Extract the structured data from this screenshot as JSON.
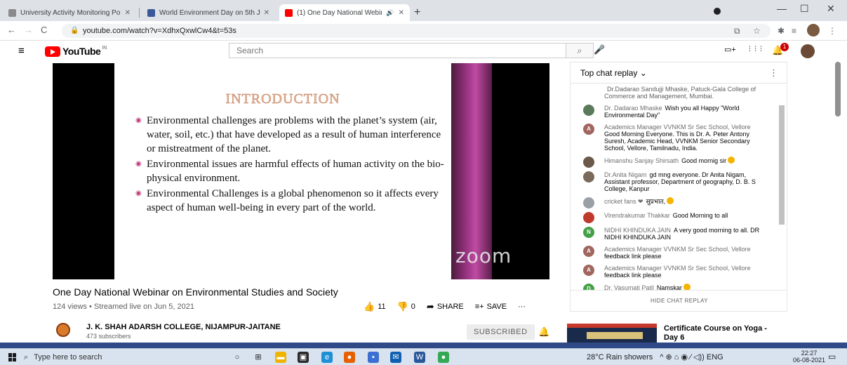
{
  "browser": {
    "tabs": [
      {
        "title": "University Activity Monitoring Po",
        "close": "✕",
        "favicon_color": "#8a8a8a"
      },
      {
        "title": "World Environment Day on 5th J",
        "close": "✕",
        "favicon_color": "#3b5998"
      },
      {
        "title": "(1) One Day National Webinar",
        "close": "✕",
        "favicon_color": "#ff0000",
        "audio": "🔊"
      }
    ],
    "new_tab": "+",
    "window_controls": {
      "minimize": "—",
      "maximize": "☐",
      "close": "✕"
    },
    "nav": {
      "back": "←",
      "forward": "→",
      "reload": "C"
    },
    "url": "youtube.com/watch?v=XdhxQxwlCw4&t=53s",
    "lock": "🔒",
    "bar_icons": {
      "share": "⧉",
      "star": "☆",
      "extensions": "✱",
      "menu": "⋮",
      "list": "≡"
    }
  },
  "youtube": {
    "menu_icon": "≡",
    "logo_text": "YouTube",
    "country": "IN",
    "search_placeholder": "Search",
    "search_icon": "⌕",
    "mic_icon": "🎤",
    "create_icon": "▭+",
    "apps_icon": "⋮⋮⋮",
    "notifications_icon": "🔔",
    "notifications_count": "1"
  },
  "video": {
    "slide_title": "INTRODUCTION",
    "bullets": [
      "Environmental challenges are problems with the planet’s system (air, water, soil, etc.) that have developed  as a result of human interference or mistreatment of the planet.",
      "Environmental issues are harmful effects of human activity on the bio-physical environment.",
      "Environmental Challenges is a global phenomenon so it affects every aspect of human well-being in every part of the world."
    ],
    "watermark": "zoom",
    "title": "One Day National Webinar on Environmental Studies and Society",
    "meta": "124 views • Streamed live on Jun 5, 2021",
    "likes": "11",
    "dislikes": "0",
    "share_label": "SHARE",
    "save_label": "SAVE",
    "more": "···",
    "like_icon": "👍",
    "dislike_icon": "👎",
    "share_icon": "➦",
    "save_icon": "≡+"
  },
  "channel": {
    "name": "J. K. SHAH ADARSH COLLEGE, NIJAMPUR-JAITANE",
    "subscribers": "473 subscribers",
    "subscribe_label": "SUBSCRIBED",
    "bell_icon": "🔔"
  },
  "chat": {
    "header": "Top chat replay",
    "chevron": "⌄",
    "menu": "⋮",
    "footer": "HIDE CHAT REPLAY",
    "messages": [
      {
        "author": "",
        "text": "Dr.Dadarao Sandujji Mhaske, Patuck-Gala College of Commerce and Management, Mumbai.",
        "avatar": "",
        "color": "#ffffff",
        "block": false
      },
      {
        "author": "Dr. Dadarao Mhaske",
        "text": "Wish you all Happy \"World Environmental Day\"",
        "avatar": "",
        "color": "#5a7a5a",
        "block": false
      },
      {
        "author": "Academics Manager VVNKM Sr Sec School, Vellore",
        "text": "Good Morning Everyone. This is Dr. A. Peter Antony Suresh, Academic Head, VVNKM Senior Secondary School, Vellore, Tamilnadu, India.",
        "avatar": "A",
        "color": "#a1665e",
        "block": true
      },
      {
        "author": "Himanshu Sanjay Shirsath",
        "text": "Good mornig sir",
        "avatar": "",
        "color": "#6b5a4a",
        "block": false,
        "emoji": true
      },
      {
        "author": "Dr.Anita Nigam",
        "text": "gd mng everyone. Dr Anita Nigam, Assistant professor, Department of geography, D. B. S College, Kanpur",
        "avatar": "",
        "color": "#7a6a5a",
        "block": false
      },
      {
        "author": "cricket fans ❤",
        "text": "सुप्रभात,",
        "avatar": "",
        "color": "#9aa0a6",
        "block": false,
        "emoji": true
      },
      {
        "author": "Virendrakumar Thakkar",
        "text": "Good Morning to all",
        "avatar": "",
        "color": "#c0392b",
        "block": false
      },
      {
        "author": "NIDHI KHINDUKA JAIN",
        "text": "A very good morning to all. DR NIDHI KHINDUKA JAIN",
        "avatar": "N",
        "color": "#43a047",
        "block": false
      },
      {
        "author": "Academics Manager VVNKM Sr Sec School, Vellore",
        "text": "feedback link please",
        "avatar": "A",
        "color": "#a1665e",
        "block": true
      },
      {
        "author": "Academics Manager VVNKM Sr Sec School, Vellore",
        "text": "feedback link please",
        "avatar": "A",
        "color": "#a1665e",
        "block": true
      },
      {
        "author": "Dr. Vasumati Patil",
        "text": "Namskar",
        "avatar": "D",
        "color": "#43a047",
        "block": false,
        "emoji": true
      }
    ]
  },
  "recommendation": {
    "title": "Certificate Course on Yoga - Day 6"
  },
  "taskbar": {
    "search_placeholder": "Type here to search",
    "search_icon": "⌕",
    "weather": "28°C  Rain showers",
    "tray": "^ ⊕ ⌂ ◉ ⁄ ◁)) ENG",
    "time": "22:27",
    "date": "06-08-2021",
    "notifications_icon": "▭",
    "apps": [
      {
        "name": "cortana",
        "glyph": "○",
        "color": "transparent"
      },
      {
        "name": "task-view",
        "glyph": "⊞",
        "color": "transparent"
      },
      {
        "name": "file-explorer",
        "glyph": "▬",
        "color": "#f0b400"
      },
      {
        "name": "store",
        "glyph": "▣",
        "color": "#2b2b2b"
      },
      {
        "name": "edge",
        "glyph": "e",
        "color": "#1f8fd6"
      },
      {
        "name": "firefox",
        "glyph": "●",
        "color": "#e66000"
      },
      {
        "name": "app",
        "glyph": "▪",
        "color": "#3c6fd1"
      },
      {
        "name": "mail",
        "glyph": "✉",
        "color": "#0f5fb3"
      },
      {
        "name": "word",
        "glyph": "W",
        "color": "#2b579a"
      },
      {
        "name": "chrome",
        "glyph": "●",
        "color": "#34a853"
      }
    ]
  }
}
